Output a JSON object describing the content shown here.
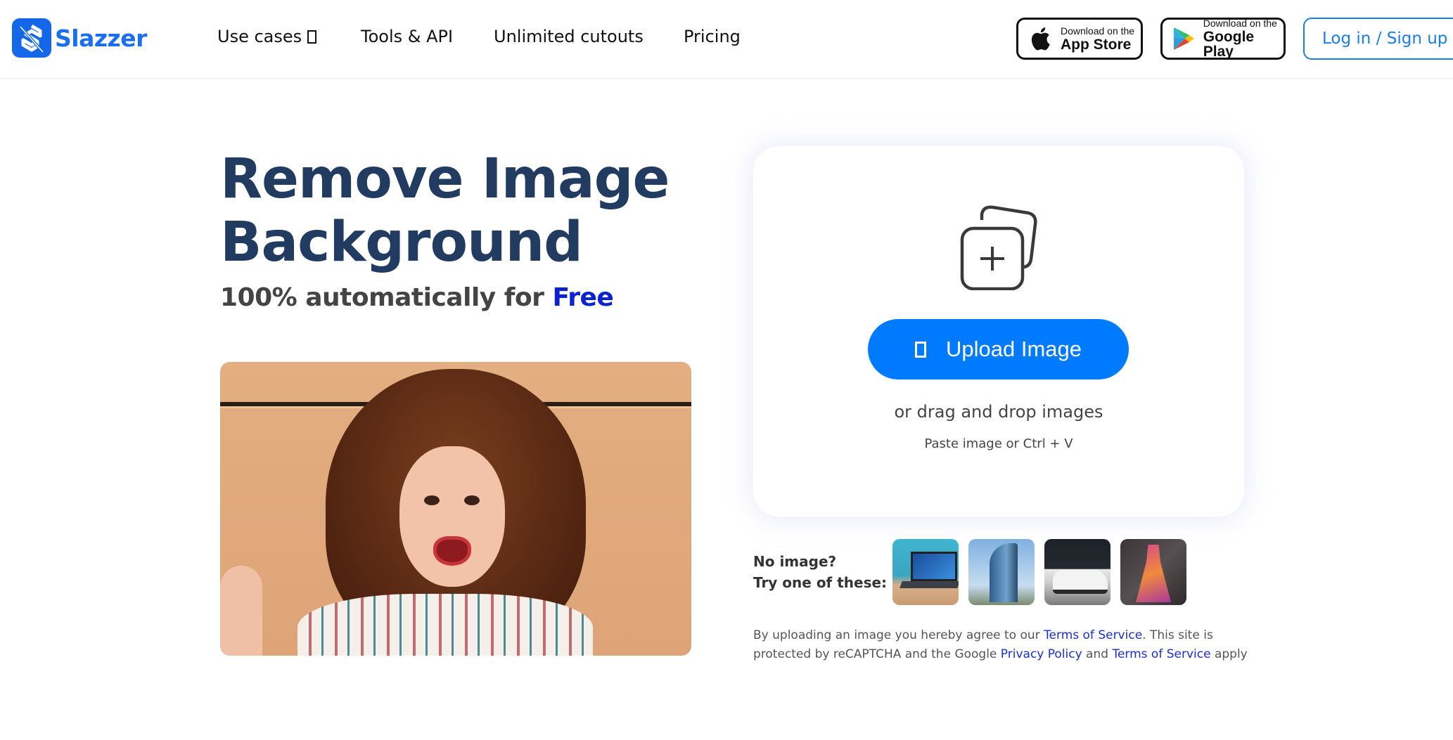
{
  "header": {
    "logo_text": "Slazzer",
    "nav": [
      {
        "label": "Use cases",
        "has_dropdown": true
      },
      {
        "label": "Tools & API"
      },
      {
        "label": "Unlimited cutouts"
      },
      {
        "label": "Pricing"
      }
    ],
    "app_store": {
      "small": "Download on the",
      "big": "App Store",
      "icon": "apple-icon"
    },
    "google_play": {
      "small": "Download on the",
      "big": "Google Play",
      "icon": "google-play-icon"
    },
    "login_label": "Log in / Sign up"
  },
  "hero": {
    "title_line1": "Remove Image",
    "title_line2": "Background",
    "subtitle_prefix": "100% automatically for ",
    "subtitle_highlight": "Free",
    "image_alt": "Smiling woman with curly hair"
  },
  "upload": {
    "icon": "add-images-icon",
    "button_label": "Upload Image",
    "drag_text": "or drag and drop images",
    "paste_text": "Paste image or Ctrl + V"
  },
  "samples": {
    "prompt_line1": "No image?",
    "prompt_line2": "Try one of these:",
    "items": [
      {
        "name": "laptop"
      },
      {
        "name": "building"
      },
      {
        "name": "car"
      },
      {
        "name": "dress"
      }
    ]
  },
  "legal": {
    "part1": "By uploading an image you hereby agree to our ",
    "link1": "Terms of Service",
    "part2": ". This site is protected by reCAPTCHA and the Google ",
    "link2": "Privacy Policy",
    "part3": " and ",
    "link3": "Terms of Service",
    "part4": " apply"
  },
  "colors": {
    "brand": "#1a6ef0",
    "headline": "#223b61",
    "free_highlight": "#0a22d0",
    "upload_button": "#007bff",
    "login_border": "#1a7ee8",
    "link": "#1a2fc8"
  }
}
